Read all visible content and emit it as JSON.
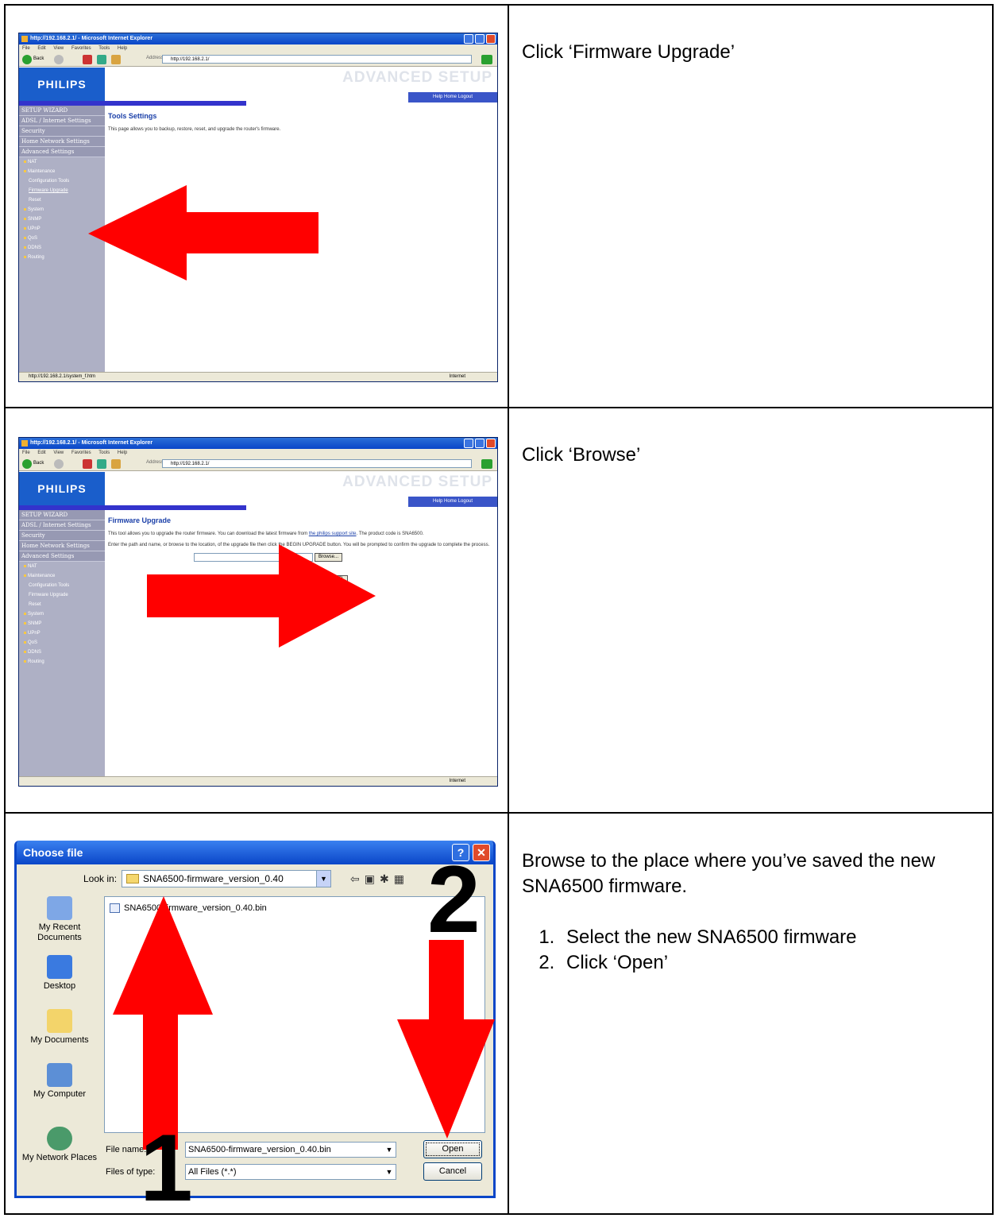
{
  "rows": [
    {
      "instruction": "Click ‘Firmware Upgrade’",
      "browser": {
        "title": "http://192.168.2.1/ - Microsoft Internet Explorer",
        "menu": [
          "File",
          "Edit",
          "View",
          "Favorites",
          "Tools",
          "Help"
        ],
        "back_label": "Back",
        "address_label": "Address",
        "address": "http://192.168.2.1/",
        "go_label": "Go",
        "status": "http://192.168.2.1/system_f.htm",
        "zone": "Internet"
      },
      "page": {
        "logo": "PHILIPS",
        "banner": "ADVANCED SETUP",
        "help_links": "Help  Home  Logout",
        "heading": "Tools Settings",
        "paragraphs": [
          "This page allows you to backup, restore, reset, and upgrade the router's firmware."
        ]
      }
    },
    {
      "instruction": "Click ‘Browse’",
      "browser": {
        "title": "http://192.168.2.1/ - Microsoft Internet Explorer",
        "menu": [
          "File",
          "Edit",
          "View",
          "Favorites",
          "Tools",
          "Help"
        ],
        "back_label": "Back",
        "address_label": "Address",
        "address": "http://192.168.2.1/",
        "go_label": "Go",
        "status": "",
        "zone": "Internet"
      },
      "page": {
        "logo": "PHILIPS",
        "banner": "ADVANCED SETUP",
        "help_links": "Help  Home  Logout",
        "heading": "Firmware Upgrade",
        "p1_text": "This tool allows you to upgrade the router firmware. You can download the latest firmware from",
        "p1_link": "the philips support site",
        "p1_tail": ". The product code is SNA6500.",
        "p2": "Enter the path and name, or browse to the location, of the upgrade file then click the BEGIN UPGRADE button. You will be prompted to confirm the upgrade to complete the process.",
        "browse_button": "Browse...",
        "begin_button": "BEGIN UPGRADE",
        "cancel_button": "CANCEL"
      }
    },
    {
      "instruction": "Browse to the place where you’ve saved the new SNA6500 firmware.",
      "steps": [
        "Select the new SNA6500 firmware",
        "Click ‘Open’"
      ],
      "dialog": {
        "title": "Choose file",
        "look_in_label": "Look in:",
        "look_in_value": "SNA6500-firmware_version_0.40",
        "places": [
          "My Recent Documents",
          "Desktop",
          "My Documents",
          "My Computer",
          "My Network Places"
        ],
        "file": "SNA6500-firmware_version_0.40.bin",
        "file_name_label": "File name:",
        "file_name_value": "SNA6500-firmware_version_0.40.bin",
        "files_of_type_label": "Files of type:",
        "files_of_type_value": "All Files (*.*)",
        "open_button": "Open",
        "cancel_button": "Cancel"
      },
      "callouts": [
        "1",
        "2"
      ]
    }
  ],
  "sidebar": {
    "sections": [
      "SETUP WIZARD",
      "ADSL / Internet Settings",
      "Security",
      "Home Network Settings",
      "Advanced Settings"
    ],
    "items": [
      "NAT",
      "Maintenance",
      "Configuration Tools",
      "Firmware Upgrade",
      "Reset",
      "System",
      "SNMP",
      "UPnP",
      "QoS",
      "DDNS",
      "Routing"
    ]
  },
  "colors": {
    "arrow": "#ff0000",
    "philips_blue": "#1a5ecb",
    "xp_title": "#0a46c8"
  }
}
